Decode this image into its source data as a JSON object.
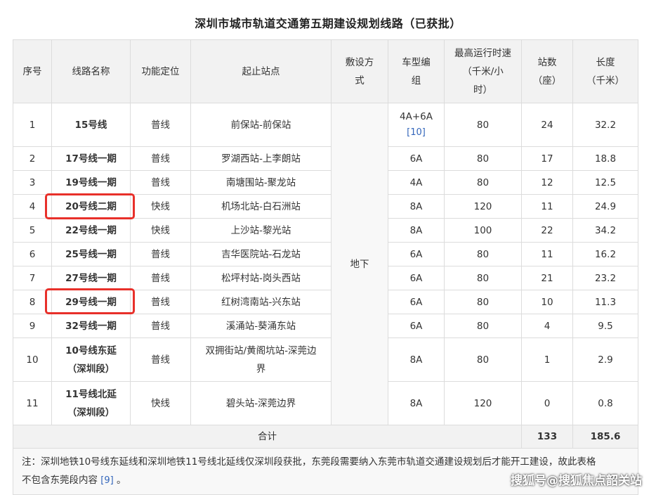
{
  "title": "深圳市城市轨道交通第五期建设规划线路（已获批）",
  "headers": [
    "序号",
    "线路名称",
    "功能定位",
    "起止站点",
    "敷设方式",
    "车型编组",
    "最高运行时速（千米/小时）",
    "站数（座）",
    "长度（千米）"
  ],
  "header_lines": {
    "h0": [
      "序号"
    ],
    "h1": [
      "线路名称"
    ],
    "h2": [
      "功能定位"
    ],
    "h3": [
      "起止站点"
    ],
    "h4": [
      "敷设方",
      "式"
    ],
    "h5": [
      "车型编",
      "组"
    ],
    "h6": [
      "最高运行时速",
      "（千米/小",
      "时）"
    ],
    "h7": [
      "站数",
      "（座）"
    ],
    "h8": [
      "长度",
      "（千米）"
    ]
  },
  "laying_method": "地下",
  "rows": [
    {
      "no": "1",
      "name": "15号线",
      "func": "普线",
      "stations": "前保站-前保站",
      "train": "4A+6A",
      "ref": "[10]",
      "speed": "80",
      "count": "24",
      "length": "32.2"
    },
    {
      "no": "2",
      "name": "17号线一期",
      "func": "普线",
      "stations": "罗湖西站-上李朗站",
      "train": "6A",
      "speed": "80",
      "count": "17",
      "length": "18.8"
    },
    {
      "no": "3",
      "name": "19号线一期",
      "func": "普线",
      "stations": "南塘围站-聚龙站",
      "train": "4A",
      "speed": "80",
      "count": "12",
      "length": "12.5"
    },
    {
      "no": "4",
      "name": "20号线二期",
      "func": "快线",
      "stations": "机场北站-白石洲站",
      "train": "8A",
      "speed": "120",
      "count": "11",
      "length": "24.9"
    },
    {
      "no": "5",
      "name": "22号线一期",
      "func": "快线",
      "stations": "上沙站-黎光站",
      "train": "8A",
      "speed": "100",
      "count": "22",
      "length": "34.2"
    },
    {
      "no": "6",
      "name": "25号线一期",
      "func": "普线",
      "stations": "吉华医院站-石龙站",
      "train": "6A",
      "speed": "80",
      "count": "11",
      "length": "16.2"
    },
    {
      "no": "7",
      "name": "27号线一期",
      "func": "普线",
      "stations": "松坪村站-岗头西站",
      "train": "6A",
      "speed": "80",
      "count": "21",
      "length": "23.2"
    },
    {
      "no": "8",
      "name": "29号线一期",
      "func": "普线",
      "stations": "红树湾南站-兴东站",
      "train": "6A",
      "speed": "80",
      "count": "10",
      "length": "11.3"
    },
    {
      "no": "9",
      "name": "32号线一期",
      "func": "普线",
      "stations": "溪涌站-葵涌东站",
      "train": "6A",
      "speed": "80",
      "count": "4",
      "length": "9.5"
    },
    {
      "no": "10",
      "name": "10号线东延（深圳段）",
      "name_lines": [
        "10号线东延",
        "（深圳段）"
      ],
      "func": "普线",
      "stations": "双拥街站/黄阁坑站-深莞边界",
      "stations_lines": [
        "双拥街站/黄阁坑站-深莞边",
        "界"
      ],
      "train": "8A",
      "speed": "80",
      "count": "1",
      "length": "2.9"
    },
    {
      "no": "11",
      "name": "11号线北延（深圳段）",
      "name_lines": [
        "11号线北延",
        "（深圳段）"
      ],
      "func": "快线",
      "stations": "碧头站-深莞边界",
      "train": "8A",
      "speed": "120",
      "count": "0",
      "length": "0.8"
    }
  ],
  "total": {
    "label": "合计",
    "count": "133",
    "length": "185.6"
  },
  "note": {
    "line1": "注：深圳地铁10号线东延线和深圳地铁11号线北延线仅深圳段获批，东莞段需要纳入东莞市轨道交通建设规划后才能开工建设，故此表格",
    "line2": "不包含东莞段内容",
    "ref": "[9]",
    "end": "。"
  },
  "watermark": "搜狐号@搜狐焦点韶关站",
  "colors": {
    "highlight": "#e8302a",
    "link": "#3366bb",
    "header_bg": "#f2f2f2",
    "border": "#dcdcdc"
  }
}
